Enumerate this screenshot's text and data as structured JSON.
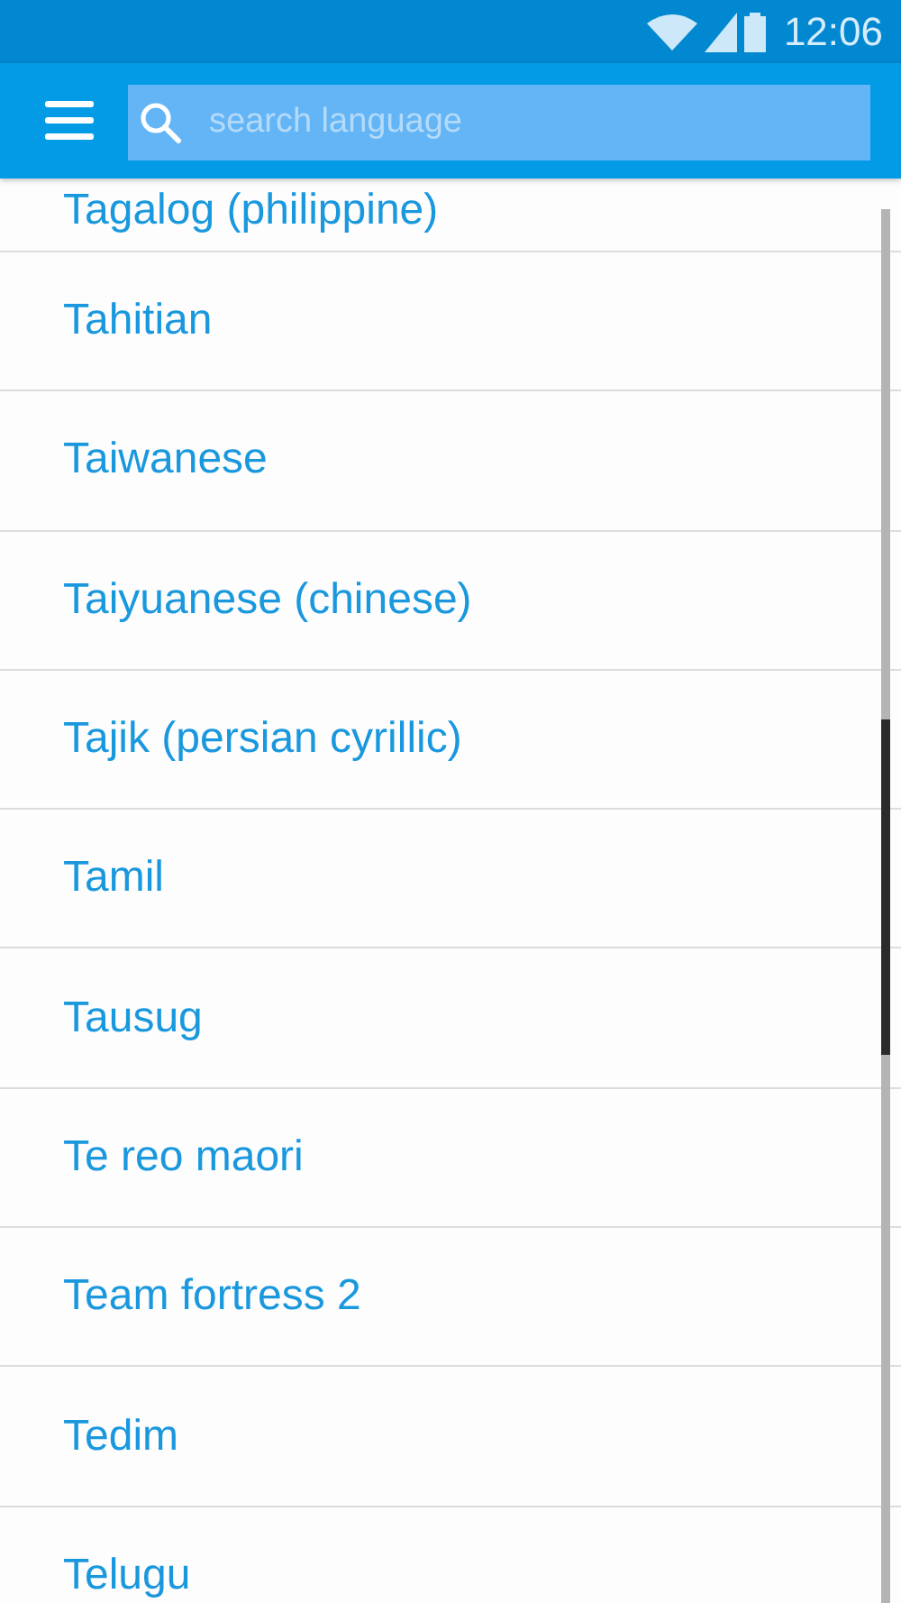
{
  "status_bar": {
    "time": "12:06"
  },
  "app_bar": {
    "search": {
      "placeholder": "search language"
    }
  },
  "languages": [
    "Tagalog (philippine)",
    "Tahitian",
    "Taiwanese",
    "Taiyuanese (chinese)",
    "Tajik (persian cyrillic)",
    "Tamil",
    "Tausug",
    "Te reo maori",
    "Team fortress 2",
    "Tedim",
    "Telugu"
  ]
}
